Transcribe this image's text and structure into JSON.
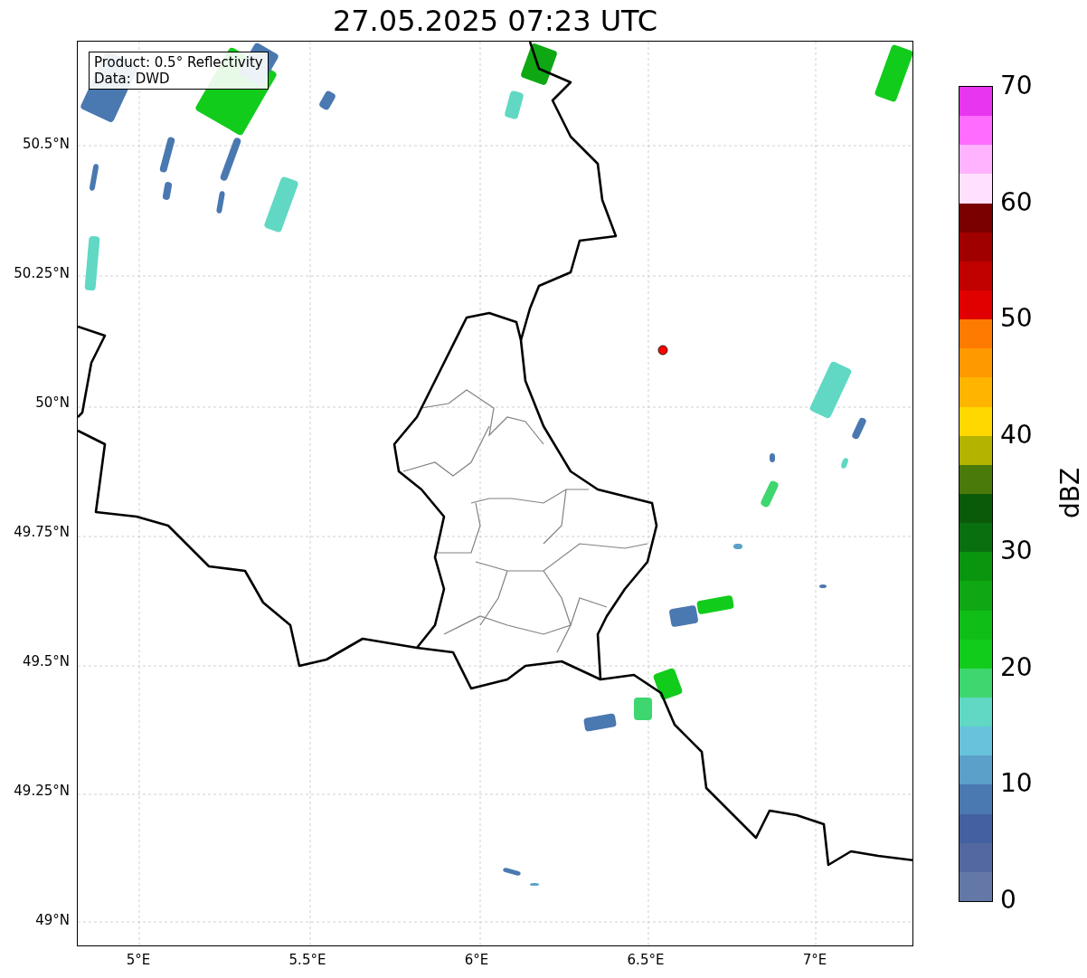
{
  "title": "27.05.2025 07:23 UTC",
  "legend_box": [
    "Product: 0.5° Reflectivity",
    "Data: DWD"
  ],
  "lat_ticks": [
    "50.5°N",
    "50.25°N",
    "50°N",
    "49.75°N",
    "49.5°N",
    "49.25°N",
    "49°N"
  ],
  "lon_ticks": [
    "5°E",
    "5.5°E",
    "6°E",
    "6.5°E",
    "7°E"
  ],
  "colorbar": {
    "label": "dBZ",
    "ticks": [
      "70",
      "60",
      "50",
      "40",
      "30",
      "20",
      "10",
      "0"
    ],
    "bands": [
      {
        "color": "#e835ef"
      },
      {
        "color": "#ff6cff"
      },
      {
        "color": "#ffb3ff"
      },
      {
        "color": "#ffe0ff"
      },
      {
        "color": "#7a0000"
      },
      {
        "color": "#a00000"
      },
      {
        "color": "#c10000"
      },
      {
        "color": "#e00000"
      },
      {
        "color": "#ff7a00"
      },
      {
        "color": "#ff9900"
      },
      {
        "color": "#ffb400"
      },
      {
        "color": "#ffd800"
      },
      {
        "color": "#b3b300"
      },
      {
        "color": "#4a7a0a"
      },
      {
        "color": "#0a5a0a"
      },
      {
        "color": "#0a700f"
      },
      {
        "color": "#0a950f"
      },
      {
        "color": "#0fa814"
      },
      {
        "color": "#10be18"
      },
      {
        "color": "#12cc1c"
      },
      {
        "color": "#3ed66e"
      },
      {
        "color": "#60d8c4"
      },
      {
        "color": "#68c2dc"
      },
      {
        "color": "#5aa0c8"
      },
      {
        "color": "#4a78b0"
      },
      {
        "color": "#4460a0"
      },
      {
        "color": "#5468a0"
      },
      {
        "color": "#6478a8"
      }
    ]
  }
}
